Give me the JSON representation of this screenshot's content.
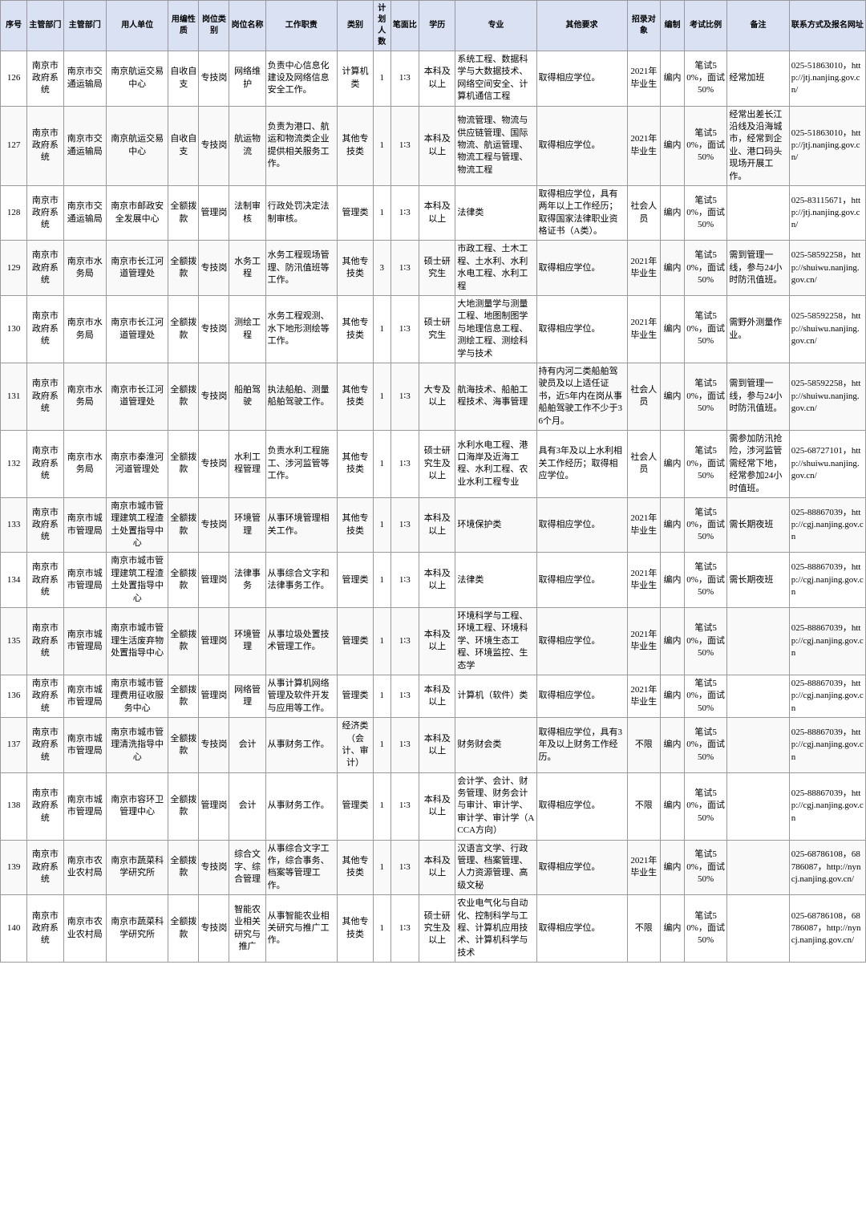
{
  "headers": [
    "序号",
    "主管部门",
    "用人单位",
    "用编性质",
    "岗位类别",
    "岗位名称",
    "工作职责",
    "类别",
    "计划人数",
    "笔面比",
    "学历",
    "专业",
    "其他要求",
    "招录对象",
    "编制",
    "考试比例",
    "备注",
    "联系方式及报名网址"
  ],
  "rows": [
    {
      "num": "126",
      "sys": "南京市政府系统",
      "dept1": "南京市交通运输局",
      "dept2": "南京航运交易中心",
      "nature": "自收自支",
      "cat": "专技岗",
      "pos": "网络维护",
      "duty": "负责中心信息化建设及网络信息安全工作。",
      "type": "计算机类",
      "cnt": "1",
      "ratio": "1∶3",
      "edu": "本科及以上",
      "major": "系统工程、数据科学与大数据技术、网络空间安全、计算机通信工程",
      "req": "取得相应学位。",
      "target": "2021年毕业生",
      "bianzhi": "编内",
      "exam": "笔试50%，面试50%",
      "note": "经常加班",
      "contact": "025-51863010，http://jtj.nanjing.gov.cn/"
    },
    {
      "num": "127",
      "sys": "南京市政府系统",
      "dept1": "南京市交通运输局",
      "dept2": "南京航运交易中心",
      "nature": "自收自支",
      "cat": "专技岗",
      "pos": "航运物流",
      "duty": "负责为港口、航运和物流类企业提供相关服务工作。",
      "type": "其他专技类",
      "cnt": "1",
      "ratio": "1∶3",
      "edu": "本科及以上",
      "major": "物流管理、物流与供应链管理、国际物流、航运管理、物流工程与管理、物流工程",
      "req": "取得相应学位。",
      "target": "2021年毕业生",
      "bianzhi": "编内",
      "exam": "笔试50%，面试50%",
      "note": "经常出差长江沿线及沿海城市，经常到企业、港口码头现场开展工作。",
      "contact": "025-51863010，http://jtj.nanjing.gov.cn/"
    },
    {
      "num": "128",
      "sys": "南京市政府系统",
      "dept1": "南京市交通运输局",
      "dept2": "南京市邮政安全发展中心",
      "nature": "全额拨款",
      "cat": "管理岗",
      "pos": "法制审核",
      "duty": "行政处罚决定法制审核。",
      "type": "管理类",
      "cnt": "1",
      "ratio": "1∶3",
      "edu": "本科及以上",
      "major": "法律类",
      "req": "取得相应学位，具有两年以上工作经历；取得国家法律职业资格证书（A类）。",
      "target": "社会人员",
      "bianzhi": "编内",
      "exam": "笔试50%，面试50%",
      "note": "",
      "contact": "025-83115671，http://jtj.nanjing.gov.cn/"
    },
    {
      "num": "129",
      "sys": "南京市政府系统",
      "dept1": "南京市水务局",
      "dept2": "南京市长江河道管理处",
      "nature": "全额拨款",
      "cat": "专技岗",
      "pos": "水务工程",
      "duty": "水务工程现场管理、防汛值班等工作。",
      "type": "其他专技类",
      "cnt": "3",
      "ratio": "1∶3",
      "edu": "硕士研究生",
      "major": "市政工程、土木工程、土水利、水利水电工程、水利工程",
      "req": "取得相应学位。",
      "target": "2021年毕业生",
      "bianzhi": "编内",
      "exam": "笔试50%，面试50%",
      "note": "需到管理一线，参与24小时防汛值班。",
      "contact": "025-58592258，http://shuiwu.nanjing.gov.cn/"
    },
    {
      "num": "130",
      "sys": "南京市政府系统",
      "dept1": "南京市水务局",
      "dept2": "南京市长江河道管理处",
      "nature": "全额拨款",
      "cat": "专技岗",
      "pos": "测绘工程",
      "duty": "水务工程观测、水下地形测绘等工作。",
      "type": "其他专技类",
      "cnt": "1",
      "ratio": "1∶3",
      "edu": "硕士研究生",
      "major": "大地测量学与测量工程、地图制图学与地理信息工程、测绘工程、测绘科学与技术",
      "req": "取得相应学位。",
      "target": "2021年毕业生",
      "bianzhi": "编内",
      "exam": "笔试50%，面试50%",
      "note": "需野外测量作业。",
      "contact": "025-58592258，http://shuiwu.nanjing.gov.cn/"
    },
    {
      "num": "131",
      "sys": "南京市政府系统",
      "dept1": "南京市水务局",
      "dept2": "南京市长江河道管理处",
      "nature": "全额拨款",
      "cat": "专技岗",
      "pos": "船舶驾驶",
      "duty": "执法船舶、测量船舶驾驶工作。",
      "type": "其他专技类",
      "cnt": "1",
      "ratio": "1∶3",
      "edu": "大专及以上",
      "major": "航海技术、船舶工程技术、海事管理",
      "req": "持有内河二类船舶驾驶员及以上适任证书，近5年内在岗从事船舶驾驶工作不少于36个月。",
      "target": "社会人员",
      "bianzhi": "编内",
      "exam": "笔试50%，面试50%",
      "note": "需到管理一线，参与24小时防汛值班。",
      "contact": "025-58592258，http://shuiwu.nanjing.gov.cn/"
    },
    {
      "num": "132",
      "sys": "南京市政府系统",
      "dept1": "南京市水务局",
      "dept2": "南京市秦淮河河道管理处",
      "nature": "全额拨款",
      "cat": "专技岗",
      "pos": "水利工程管理",
      "duty": "负责水利工程施工、涉河监管等工作。",
      "type": "其他专技类",
      "cnt": "1",
      "ratio": "1∶3",
      "edu": "硕士研究生及以上",
      "major": "水利水电工程、港口海岸及近海工程、水利工程、农业水利工程专业",
      "req": "具有3年及以上水利相关工作经历；取得相应学位。",
      "target": "社会人员",
      "bianzhi": "编内",
      "exam": "笔试50%，面试50%",
      "note": "需参加防汛抢险，涉河监管需经常下地，经常参加24小时值班。",
      "contact": "025-68727101，http://shuiwu.nanjing.gov.cn/"
    },
    {
      "num": "133",
      "sys": "南京市政府系统",
      "dept1": "南京市城市管理局",
      "dept2": "南京市城市管理建筑工程渣土处置指导中心",
      "nature": "全额拨款",
      "cat": "专技岗",
      "pos": "环境管理",
      "duty": "从事环境管理相关工作。",
      "type": "其他专技类",
      "cnt": "1",
      "ratio": "1∶3",
      "edu": "本科及以上",
      "major": "环境保护类",
      "req": "取得相应学位。",
      "target": "2021年毕业生",
      "bianzhi": "编内",
      "exam": "笔试50%，面试50%",
      "note": "需长期夜班",
      "contact": "025-88867039，http://cgj.nanjing.gov.cn"
    },
    {
      "num": "134",
      "sys": "南京市政府系统",
      "dept1": "南京市城市管理局",
      "dept2": "南京市城市管理建筑工程渣土处置指导中心",
      "nature": "全额拨款",
      "cat": "管理岗",
      "pos": "法律事务",
      "duty": "从事综合文字和法律事务工作。",
      "type": "管理类",
      "cnt": "1",
      "ratio": "1∶3",
      "edu": "本科及以上",
      "major": "法律类",
      "req": "取得相应学位。",
      "target": "2021年毕业生",
      "bianzhi": "编内",
      "exam": "笔试50%，面试50%",
      "note": "需长期夜班",
      "contact": "025-88867039，http://cgj.nanjing.gov.cn"
    },
    {
      "num": "135",
      "sys": "南京市政府系统",
      "dept1": "南京市城市管理局",
      "dept2": "南京市城市管理生活废弃物处置指导中心",
      "nature": "全额拨款",
      "cat": "管理岗",
      "pos": "环境管理",
      "duty": "从事垃圾处置技术管理工作。",
      "type": "管理类",
      "cnt": "1",
      "ratio": "1∶3",
      "edu": "本科及以上",
      "major": "环境科学与工程、环境工程、环境科学、环境生态工程、环境监控、生态学",
      "req": "取得相应学位。",
      "target": "2021年毕业生",
      "bianzhi": "编内",
      "exam": "笔试50%，面试50%",
      "note": "",
      "contact": "025-88867039，http://cgj.nanjing.gov.cn"
    },
    {
      "num": "136",
      "sys": "南京市政府系统",
      "dept1": "南京市城市管理局",
      "dept2": "南京市城市管理费用征收服务中心",
      "nature": "全额拨款",
      "cat": "管理岗",
      "pos": "网络管理",
      "duty": "从事计算机网络管理及软件开发与应用等工作。",
      "type": "管理类",
      "cnt": "1",
      "ratio": "1∶3",
      "edu": "本科及以上",
      "major": "计算机（软件）类",
      "req": "取得相应学位。",
      "target": "2021年毕业生",
      "bianzhi": "编内",
      "exam": "笔试50%，面试50%",
      "note": "",
      "contact": "025-88867039，http://cgj.nanjing.gov.cn"
    },
    {
      "num": "137",
      "sys": "南京市政府系统",
      "dept1": "南京市城市管理局",
      "dept2": "南京市城市管理清洗指导中心",
      "nature": "全额拨款",
      "cat": "专技岗",
      "pos": "会计",
      "duty": "从事财务工作。",
      "type": "经济类（会计、审计）",
      "cnt": "1",
      "ratio": "1∶3",
      "edu": "本科及以上",
      "major": "财务财会类",
      "req": "取得相应学位，具有3年及以上财务工作经历。",
      "target": "不限",
      "bianzhi": "编内",
      "exam": "笔试50%，面试50%",
      "note": "",
      "contact": "025-88867039，http://cgj.nanjing.gov.cn"
    },
    {
      "num": "138",
      "sys": "南京市政府系统",
      "dept1": "南京市城市管理局",
      "dept2": "南京市容环卫管理中心",
      "nature": "全额拨款",
      "cat": "管理岗",
      "pos": "会计",
      "duty": "从事财务工作。",
      "type": "管理类",
      "cnt": "1",
      "ratio": "1∶3",
      "edu": "本科及以上",
      "major": "会计学、会计、财务管理、财务会计与审计、审计学、审计学、审计学（ACCA方向）",
      "req": "取得相应学位。",
      "target": "不限",
      "bianzhi": "编内",
      "exam": "笔试50%，面试50%",
      "note": "",
      "contact": "025-88867039，http://cgj.nanjing.gov.cn"
    },
    {
      "num": "139",
      "sys": "南京市政府系统",
      "dept1": "南京市农业农村局",
      "dept2": "南京市蔬菜科学研究所",
      "nature": "全额拨款",
      "cat": "专技岗",
      "pos": "综合文字、综合管理",
      "duty": "从事综合文字工作，综合事务、档案等管理工作。",
      "type": "其他专技类",
      "cnt": "1",
      "ratio": "1∶3",
      "edu": "本科及以上",
      "major": "汉语言文学、行政管理、档案管理、人力资源管理、高级文秘",
      "req": "取得相应学位。",
      "target": "2021年毕业生",
      "bianzhi": "编内",
      "exam": "笔试50%，面试50%",
      "note": "",
      "contact": "025-68786108，68786087，http://nyncj.nanjing.gov.cn/"
    },
    {
      "num": "140",
      "sys": "南京市政府系统",
      "dept1": "南京市农业农村局",
      "dept2": "南京市蔬菜科学研究所",
      "nature": "全额拨款",
      "cat": "专技岗",
      "pos": "智能农业相关研究与推广",
      "duty": "从事智能农业相关研究与推广工作。",
      "type": "其他专技类",
      "cnt": "1",
      "ratio": "1∶3",
      "edu": "硕士研究生及以上",
      "major": "农业电气化与自动化、控制科学与工程、计算机应用技术、计算机科学与技术",
      "req": "取得相应学位。",
      "target": "不限",
      "bianzhi": "编内",
      "exam": "笔试50%，面试50%",
      "note": "",
      "contact": "025-68786108，68786087，http://nyncj.nanjing.gov.cn/"
    }
  ]
}
